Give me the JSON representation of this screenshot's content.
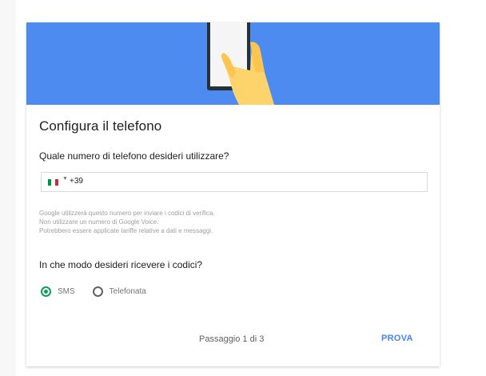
{
  "header": {
    "illustration": "hand-holding-phone-icon",
    "background_color": "#4d8bf0"
  },
  "title": "Configura il telefono",
  "phone": {
    "question": "Quale numero di telefono desideri utilizzare?",
    "country_flag": "italy-flag-icon",
    "country_prefix": "+39",
    "value": ""
  },
  "notes": [
    "Google utilizzerà questo numero per inviare i codici di verifica.",
    "Non utilizzare un numero di Google Voice.",
    "Potrebbero essere applicate tariffe relative a dati e messaggi."
  ],
  "method": {
    "question": "In che modo desideri ricevere i codici?",
    "options": [
      {
        "label": "SMS",
        "selected": true
      },
      {
        "label": "Telefonata",
        "selected": false
      }
    ],
    "accent_color": "#0f9d58"
  },
  "footer": {
    "step_text": "Passaggio 1 di 3",
    "next_label": "PROVA",
    "link_color": "#4285f4"
  }
}
